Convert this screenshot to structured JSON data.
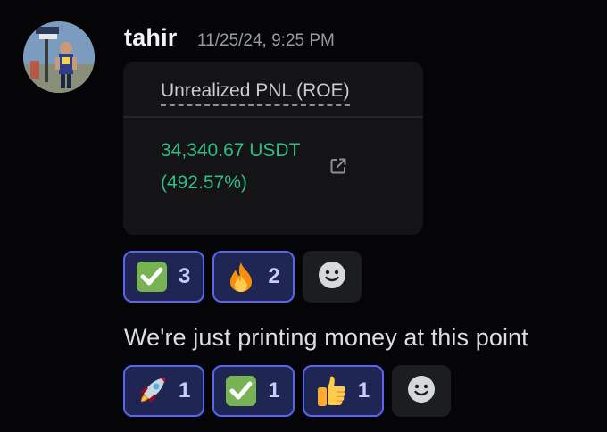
{
  "message1": {
    "author": "tahir",
    "timestamp": "11/25/24, 9:25 PM",
    "embed": {
      "label": "Unrealized PNL (ROE)",
      "amount": "34,340.67 USDT",
      "percent": "(492.57%)",
      "link_icon": "external-link-icon"
    },
    "reactions": [
      {
        "emoji": "check-mark-emoji",
        "count": "3"
      },
      {
        "emoji": "fire-emoji",
        "count": "2"
      }
    ],
    "add_reaction_icon": "add-reaction-smiley-icon"
  },
  "message2": {
    "text": "We're just printing money at this point",
    "reactions": [
      {
        "emoji": "rocket-emoji",
        "count": "1"
      },
      {
        "emoji": "check-mark-emoji",
        "count": "1"
      },
      {
        "emoji": "thumbs-up-emoji",
        "count": "1"
      }
    ],
    "add_reaction_icon": "add-reaction-smiley-icon"
  },
  "colors": {
    "background": "#050507",
    "profit_green": "#2ebd85",
    "reaction_border": "#5865f2",
    "reaction_bg": "#202654",
    "timestamp": "#949ba4"
  }
}
